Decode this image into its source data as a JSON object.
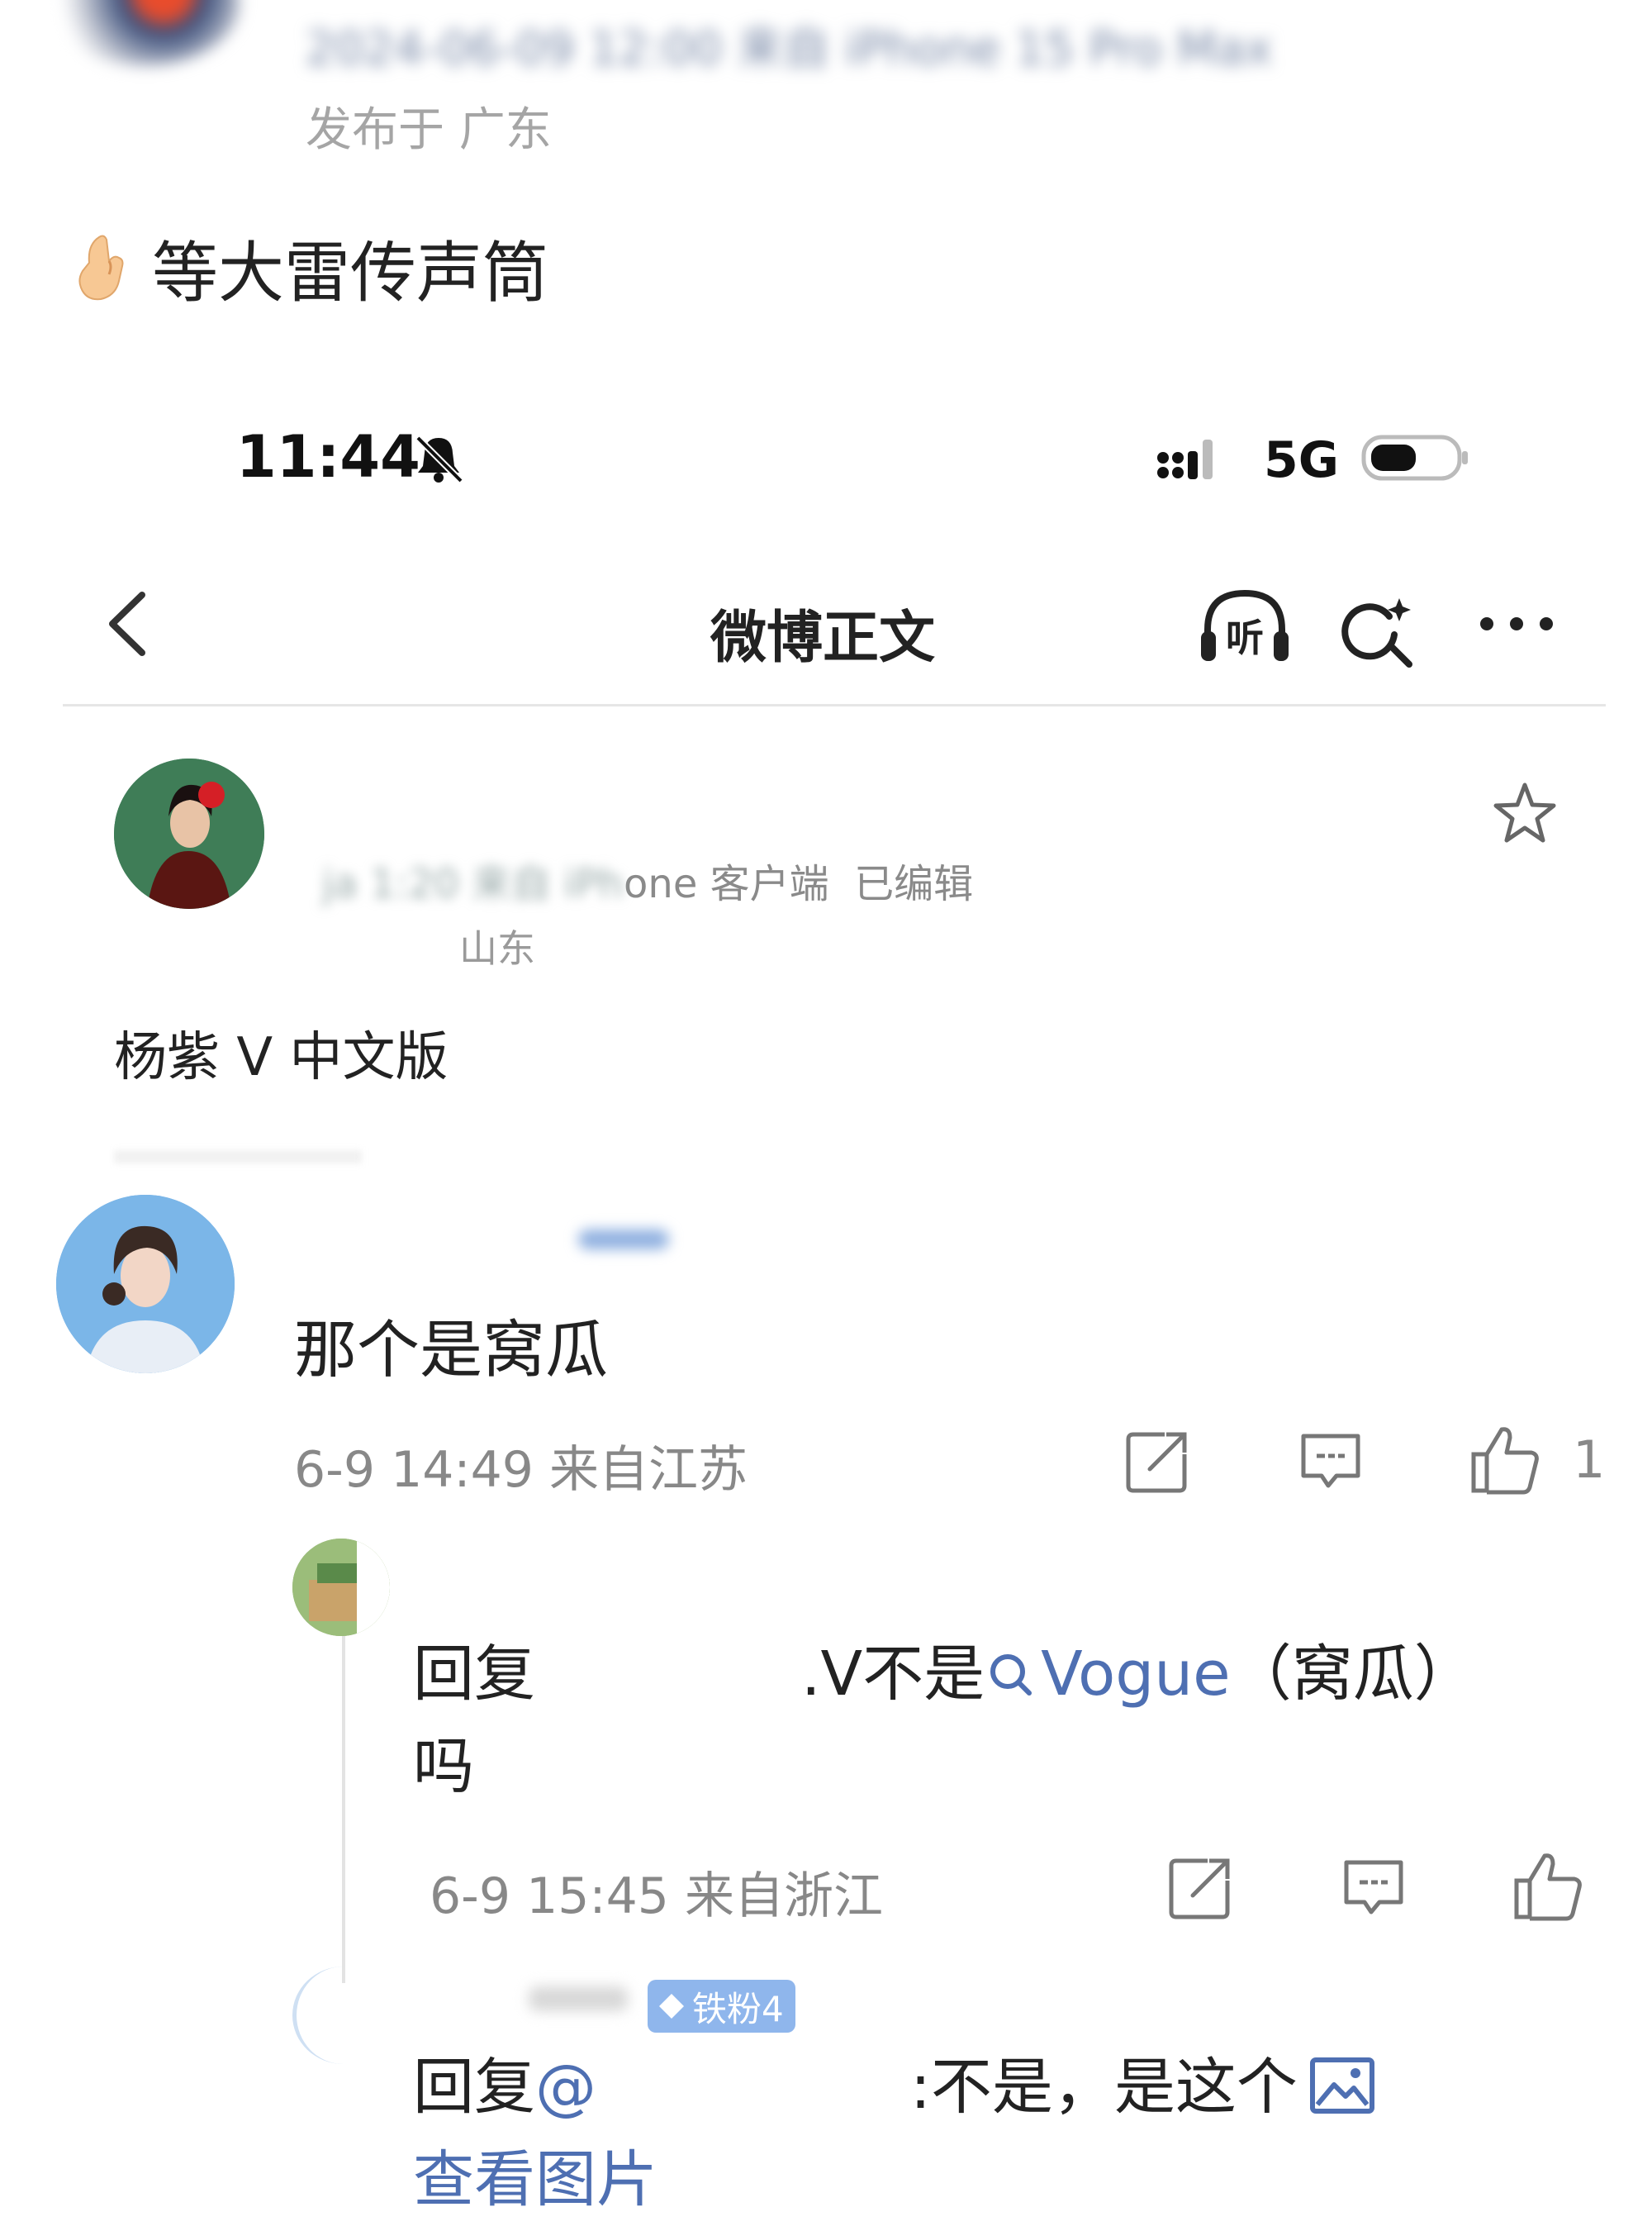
{
  "outer_post": {
    "meta": "2024-06-09 12:00 来自 iPhone 15 Pro Max",
    "location": "发布于 广东",
    "text": "等大雷传声筒"
  },
  "status_bar": {
    "time": "11:44",
    "network": "5G"
  },
  "nav": {
    "title": "微博正文"
  },
  "post": {
    "meta_client": "one 客户端",
    "meta_edited": "已编辑",
    "location": "山东",
    "text": "杨紫 V 中文版"
  },
  "comment": {
    "text": "那个是窝瓜",
    "time": "6-9 14:49 来自江苏",
    "like_count": "1"
  },
  "reply1": {
    "prefix": "回复",
    "mid": ".V不是",
    "topic": "Vogue",
    "suffix": "（窝瓜）吗",
    "time": "6-9 15:45 来自浙江"
  },
  "reply2": {
    "badge": "铁粉4",
    "prefix": "回复",
    "mention_mark": "@",
    "body": ":不是，是这个",
    "view_image": "查看图片"
  },
  "colors": {
    "link": "#4e6fb2",
    "meta_gray": "#888888",
    "badge_blue": "#8fb6ec"
  },
  "icons": [
    "hand-emoji",
    "bell-off-icon",
    "signal-icon",
    "battery-icon",
    "back-icon",
    "listen-icon",
    "search-icon",
    "more-icon",
    "star-icon",
    "share-icon",
    "reply-icon",
    "like-icon",
    "diamond-icon",
    "image-icon"
  ]
}
